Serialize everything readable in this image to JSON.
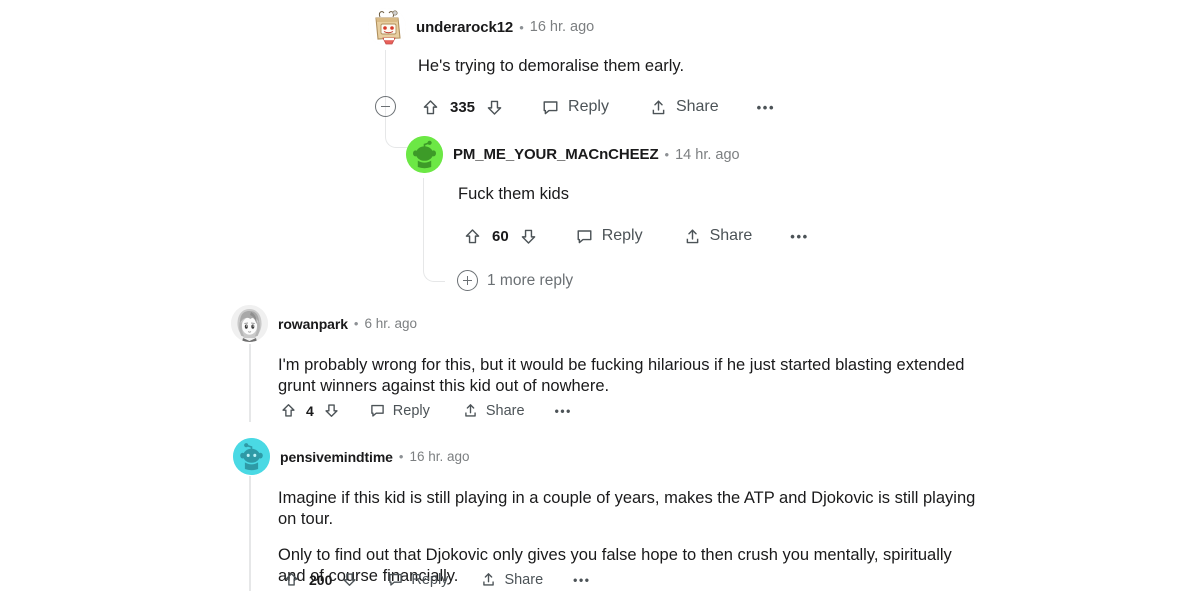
{
  "page": {
    "platform": "reddit-comment-thread",
    "background_color": "#ffffff",
    "text_color": "#1a1a1b",
    "meta_color": "#7c7f81",
    "action_color": "#4c5357",
    "thread_line_color": "#e6e7e8"
  },
  "labels": {
    "reply": "Reply",
    "share": "Share",
    "more_options": "•••",
    "separator": "•"
  },
  "icons": {
    "upvote": "upvote-arrow-icon",
    "downvote": "downvote-arrow-icon",
    "reply": "speech-bubble-icon",
    "share": "share-arrow-icon",
    "overflow": "more-options-icon",
    "collapse": "collapse-minus-icon",
    "expand": "expand-plus-icon"
  },
  "comments": [
    {
      "id": "c1",
      "username": "underarock12",
      "timestamp": "16 hr. ago",
      "avatar": {
        "name": "cardboard-box-head-avatar",
        "bg": "#f2efe9",
        "accent": "#c9a06a"
      },
      "depth": 0,
      "paragraphs": [
        "He's trying to demoralise them early."
      ],
      "score": "335",
      "reply_label": "Reply",
      "share_label": "Share",
      "collapsed": false
    },
    {
      "id": "c2",
      "username": "PM_ME_YOUR_MACnCHEEZ",
      "timestamp": "14 hr. ago",
      "avatar": {
        "name": "green-snoo-avatar",
        "bg": "#6ce845",
        "accent": "#3d9b28"
      },
      "depth": 1,
      "paragraphs": [
        "Fuck them kids"
      ],
      "score": "60",
      "reply_label": "Reply",
      "share_label": "Share"
    },
    {
      "id": "c3",
      "username": "rowanpark",
      "timestamp": "6 hr. ago",
      "avatar": {
        "name": "anime-portrait-avatar",
        "bg": "#e9e9e9",
        "accent": "#8c8c8c"
      },
      "depth": 0,
      "paragraphs": [
        "I'm probably wrong for this, but it would be fucking hilarious if he just started blasting extended grunt winners against this kid out of nowhere."
      ],
      "score": "4",
      "reply_label": "Reply",
      "share_label": "Share"
    },
    {
      "id": "c4",
      "username": "pensivemindtime",
      "timestamp": "16 hr. ago",
      "avatar": {
        "name": "cyan-snoo-avatar",
        "bg": "#4ad9e4",
        "accent": "#2e9aa6"
      },
      "depth": 0,
      "paragraphs": [
        "Imagine if this kid is still playing in a couple of years, makes the ATP and Djokovic is still playing on tour.",
        "Only to find out that Djokovic only gives you false hope to then crush you mentally, spiritually and of course financially."
      ],
      "score": "200",
      "reply_label": "Reply",
      "share_label": "Share"
    }
  ],
  "more_replies": {
    "label": "1 more reply",
    "count": 1
  }
}
